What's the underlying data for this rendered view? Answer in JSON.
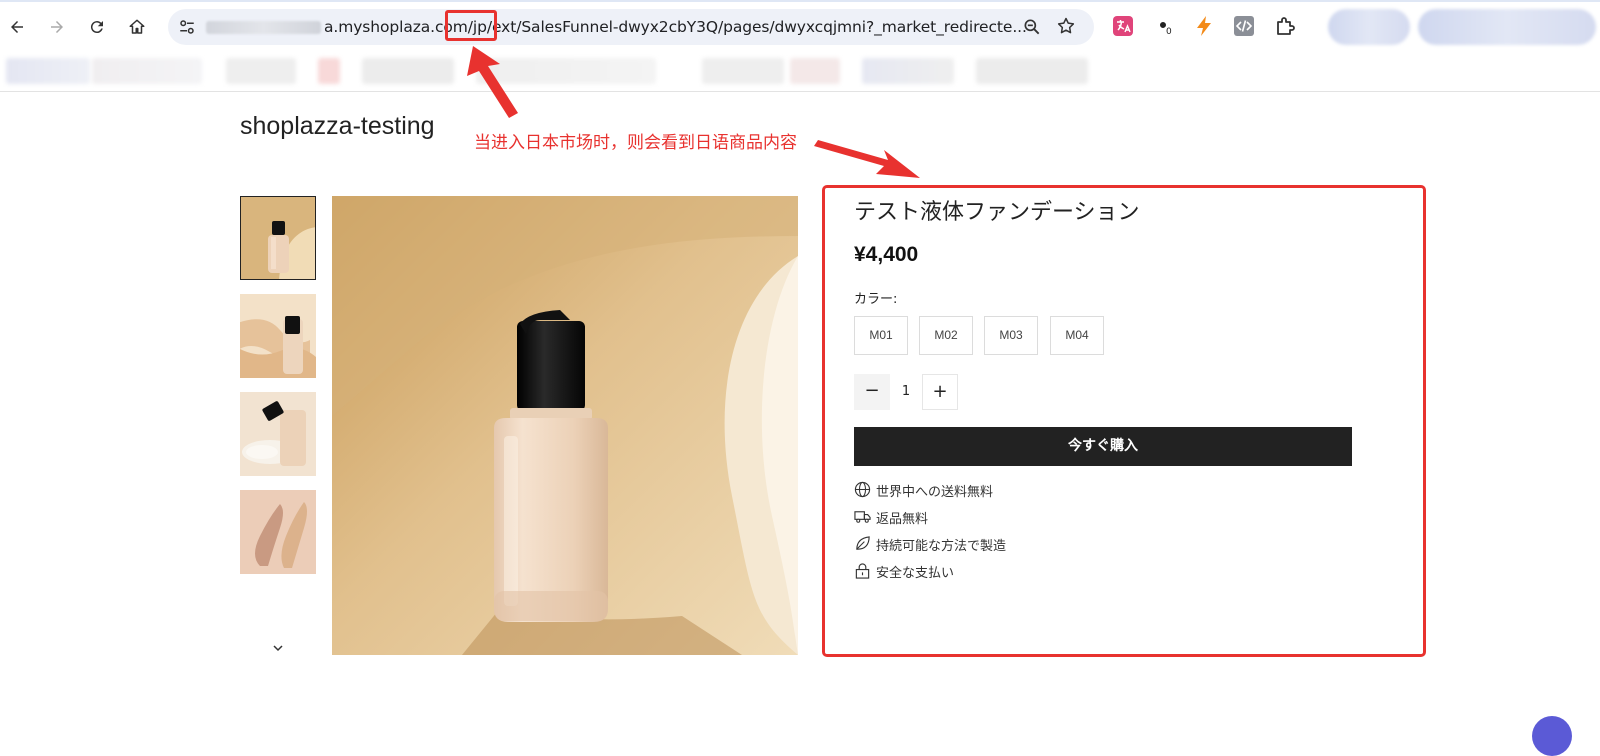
{
  "browser": {
    "url_text": "a.myshoplaza.com/jp/ext/SalesFunnel-dwyx2cbY3Q/pages/dwyxcqjmni?_market_redirecte...",
    "extension_badge": "0"
  },
  "annotation": {
    "text": "当进入日本市场时，则会看到日语商品内容",
    "color": "#e8322f"
  },
  "store": {
    "title": "shoplazza-testing"
  },
  "gallery": {
    "thumbnails": 4,
    "active_index": 0
  },
  "product": {
    "name": "テスト液体ファンデーション",
    "price": "¥4,400",
    "color_label": "カラー:",
    "variants": [
      "M01",
      "M02",
      "M03",
      "M04"
    ],
    "quantity": "1",
    "qty_minus": "−",
    "qty_plus": "+",
    "buy_label": "今すぐ購入",
    "features": [
      {
        "icon": "globe-icon",
        "text": "世界中への送料無料"
      },
      {
        "icon": "truck-icon",
        "text": "返品無料"
      },
      {
        "icon": "leaf-icon",
        "text": "持続可能な方法で製造"
      },
      {
        "icon": "lock-icon",
        "text": "安全な支払い"
      }
    ]
  },
  "colors": {
    "accent_red": "#e8322f",
    "button_dark": "#222222",
    "omnibox_bg": "#eef1f8"
  }
}
